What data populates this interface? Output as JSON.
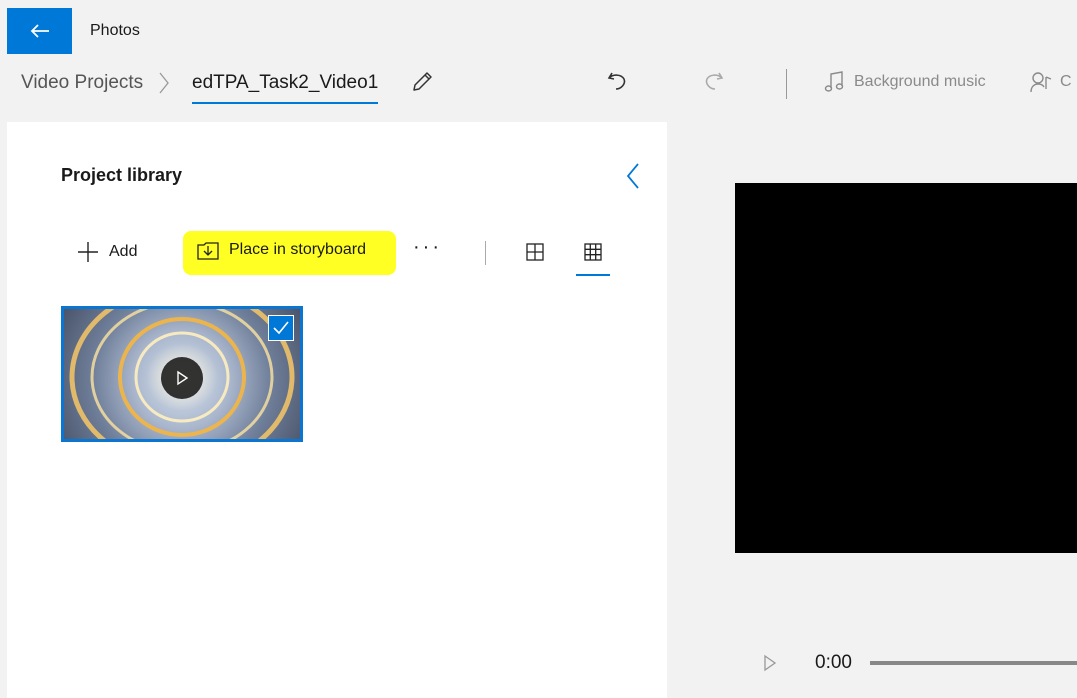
{
  "app": {
    "title": "Photos",
    "accent": "#0078d7"
  },
  "breadcrumb": {
    "root": "Video Projects",
    "current": "edTPA_Task2_Video1"
  },
  "toolbar": {
    "background_music_label": "Background music",
    "custom_audio_label": "C",
    "icons": [
      "back-arrow-icon",
      "chevron-right-icon",
      "pencil-icon",
      "undo-icon",
      "redo-icon",
      "music-note-icon",
      "custom-audio-icon"
    ]
  },
  "library": {
    "title": "Project library",
    "add_label": "Add",
    "place_label": "Place in storyboard",
    "highlight_color": "#ffff24",
    "items": [
      {
        "selected": true,
        "type": "video"
      }
    ]
  },
  "preview": {
    "time": "0:00"
  }
}
